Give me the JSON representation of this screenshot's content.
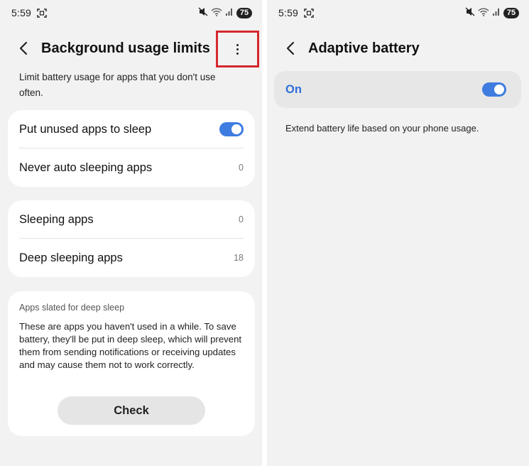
{
  "status_bar": {
    "time": "5:59",
    "battery": "75",
    "icons": [
      "screenshot-icon",
      "mute-icon",
      "wifi-icon",
      "signal-icon",
      "battery-icon"
    ]
  },
  "left": {
    "title": "Background usage limits",
    "description": "Limit battery usage for apps that you don't use often.",
    "group1": {
      "put_unused_label": "Put unused apps to sleep",
      "put_unused_enabled": true,
      "never_auto_label": "Never auto sleeping apps",
      "never_auto_count": "0"
    },
    "group2": {
      "sleeping_label": "Sleeping apps",
      "sleeping_count": "0",
      "deep_sleeping_label": "Deep sleeping apps",
      "deep_sleeping_count": "18"
    },
    "info": {
      "title": "Apps slated for deep sleep",
      "text": "These are apps you haven't used in a while. To save battery, they'll be put in deep sleep, which will prevent them from sending notifications or receiving updates and may cause them not to work correctly.",
      "button": "Check"
    },
    "highlight_color": "#d6282d"
  },
  "right": {
    "title": "Adaptive battery",
    "switch_label": "On",
    "switch_enabled": true,
    "description": "Extend battery life based on your phone usage."
  },
  "colors": {
    "accent": "#3e7ce0",
    "on_text": "#2e6fd9"
  }
}
